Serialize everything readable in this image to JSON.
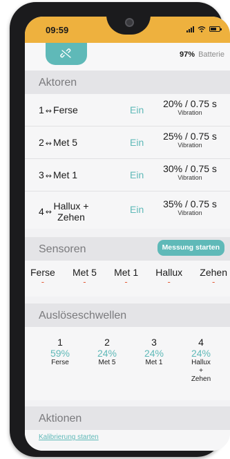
{
  "status": {
    "time": "09:59"
  },
  "topbar": {
    "battery_percent": "97%",
    "battery_label": "Batterie"
  },
  "aktoren": {
    "title": "Aktoren",
    "link_symbol": "↭",
    "items": [
      {
        "num": "1",
        "name": "Ferse",
        "state": "Ein",
        "value": "20% / 0.75 s",
        "mode": "Vibration"
      },
      {
        "num": "2",
        "name": "Met 5",
        "state": "Ein",
        "value": "25% / 0.75 s",
        "mode": "Vibration"
      },
      {
        "num": "3",
        "name": "Met 1",
        "state": "Ein",
        "value": "30% / 0.75 s",
        "mode": "Vibration"
      },
      {
        "num": "4",
        "name": "Hallux + Zehen",
        "state": "Ein",
        "value": "35% / 0.75 s",
        "mode": "Vibration"
      }
    ]
  },
  "sensoren": {
    "title": "Sensoren",
    "button": "Messung starten",
    "items": [
      {
        "name": "Ferse",
        "value": "-"
      },
      {
        "name": "Met 5",
        "value": "-"
      },
      {
        "name": "Met 1",
        "value": "-"
      },
      {
        "name": "Hallux",
        "value": "-"
      },
      {
        "name": "Zehen",
        "value": "-"
      }
    ]
  },
  "schwellen": {
    "title": "Auslöseschwellen",
    "items": [
      {
        "num": "1",
        "pct": "59%",
        "label": "Ferse"
      },
      {
        "num": "2",
        "pct": "24%",
        "label": "Met 5"
      },
      {
        "num": "3",
        "pct": "24%",
        "label": "Met 1"
      },
      {
        "num": "4",
        "pct": "24%",
        "label": "Hallux\n+\nZehen"
      }
    ]
  },
  "aktionen": {
    "title": "Aktionen",
    "link": "Kalibrierung starten"
  }
}
